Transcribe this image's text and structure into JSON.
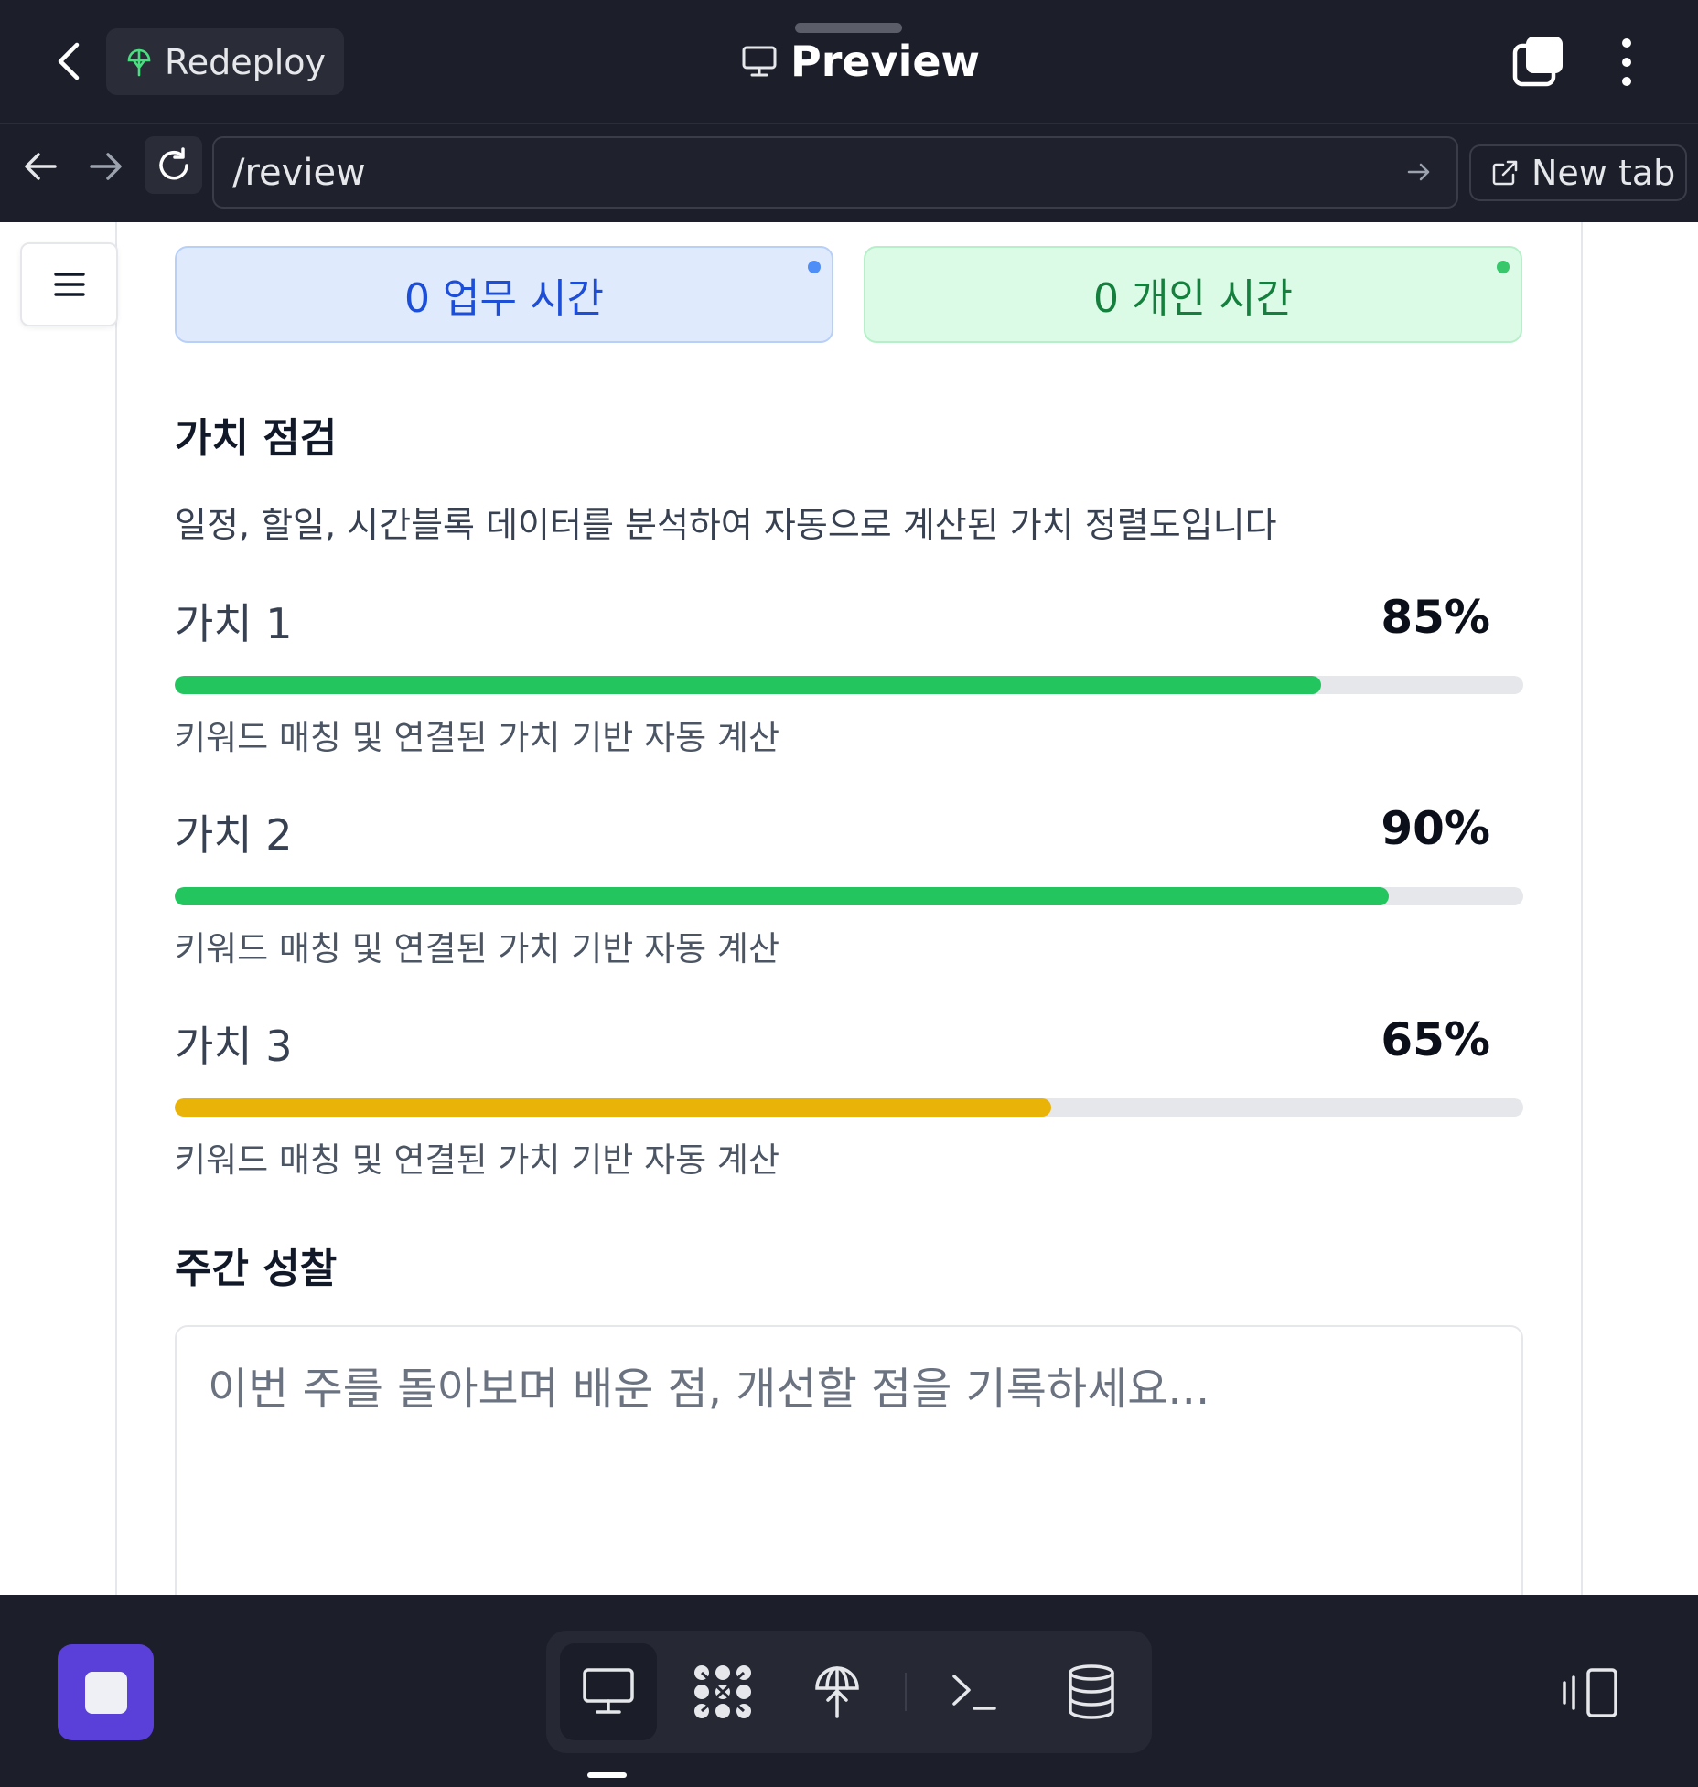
{
  "topbar": {
    "redeploy_label": "Redeploy",
    "title": "Preview"
  },
  "addressbar": {
    "url": "/review",
    "new_tab_label": "New tab"
  },
  "stats": {
    "work": "0 업무 시간",
    "personal": "0 개인 시간"
  },
  "values_section": {
    "title": "가치 점검",
    "description": "일정, 할일, 시간블록 데이터를 분석하여 자동으로 계산된 가치 정렬도입니다",
    "items": [
      {
        "name": "가치 1",
        "percent_label": "85%",
        "percent": 85,
        "note": "키워드 매칭 및 연결된 가치 기반 자동 계산",
        "color": "#22c55e"
      },
      {
        "name": "가치 2",
        "percent_label": "90%",
        "percent": 90,
        "note": "키워드 매칭 및 연결된 가치 기반 자동 계산",
        "color": "#22c55e"
      },
      {
        "name": "가치 3",
        "percent_label": "65%",
        "percent": 65,
        "note": "키워드 매칭 및 연결된 가치 기반 자동 계산",
        "color": "#eab308"
      }
    ]
  },
  "reflection": {
    "title": "주간 성찰",
    "placeholder": "이번 주를 돌아보며 배운 점, 개선할 점을 기록하세요...",
    "value": ""
  },
  "icons": {
    "back": "chevron-left-icon",
    "redeploy": "deploy-icon",
    "preview": "monitor-icon",
    "tabs": "tabs-icon",
    "more": "more-vertical-icon",
    "menu": "hamburger-icon",
    "toolbar": [
      "monitor-icon",
      "apps-icon",
      "deploy-icon",
      "terminal-icon",
      "database-icon"
    ],
    "panel": "panel-toggle-icon"
  },
  "colors": {
    "chrome_bg": "#1c1f2a",
    "accent": "#5b3fd9",
    "work": "#1d4ed8",
    "personal": "#15803d"
  }
}
